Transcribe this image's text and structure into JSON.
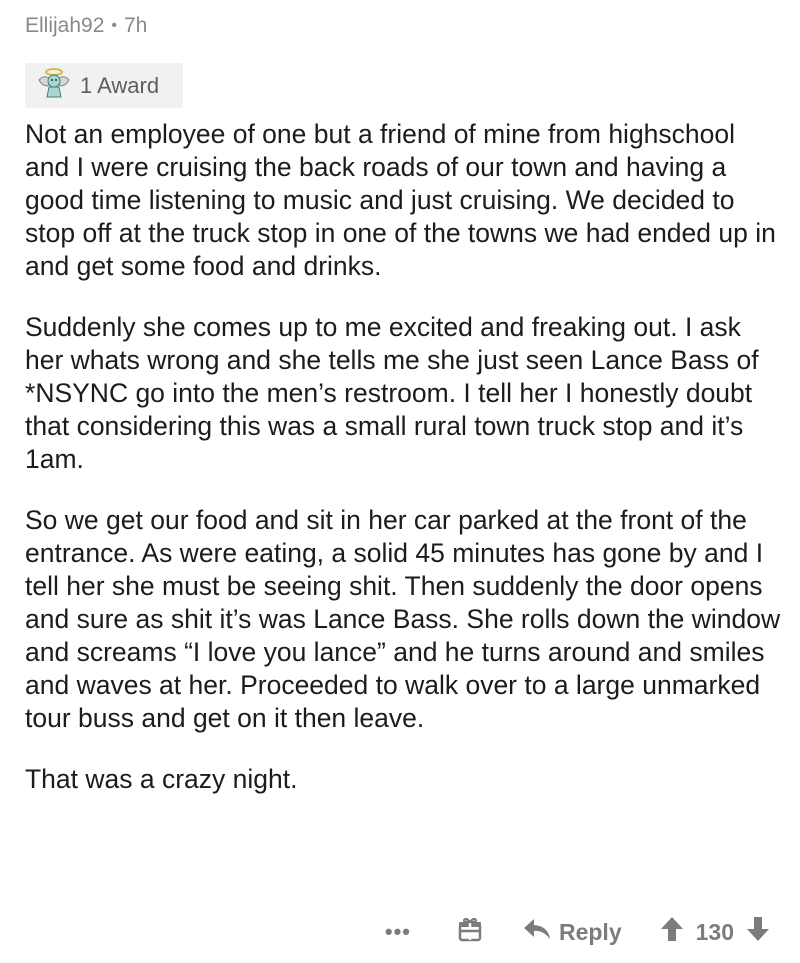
{
  "comment": {
    "author": "Ellijah92",
    "separator": "•",
    "age": "7h",
    "award_label": "1 Award",
    "paragraphs": [
      "Not an employee of one but a friend of mine from highschool and I were cruising the back roads of our town and having a good time listening to music and just cruising. We decided to stop off at the truck stop in one of the towns we had ended up in and get some food and drinks.",
      "Suddenly she comes up to me excited and freaking out. I ask her whats wrong and she tells me she just seen Lance Bass of *NSYNC go into the men’s restroom. I tell her I honestly doubt that considering this was a small rural town truck stop and it’s 1am.",
      "So we get our food and sit in her car parked at the front of the entrance. As were eating, a solid 45 minutes has gone by and I tell her she must be seeing shit. Then suddenly the door opens and sure as shit it’s was Lance Bass. She rolls down the window and screams “I love you lance” and he turns around and smiles and waves at her. Proceeded to walk over to a large unmarked tour buss and get on it then leave.",
      "That was a crazy night."
    ]
  },
  "actions": {
    "more_label": "•••",
    "reply_label": "Reply",
    "score": "130"
  },
  "icons": {
    "award": "angel-award-icon",
    "gift": "gift-icon",
    "reply": "reply-arrow-icon",
    "upvote": "upvote-arrow-icon",
    "downvote": "downvote-arrow-icon"
  },
  "colors": {
    "meta_text": "#878a8c",
    "body_text": "#1c1c1c",
    "action_text": "#7c7c7c",
    "award_bg": "#f1f1f1"
  }
}
